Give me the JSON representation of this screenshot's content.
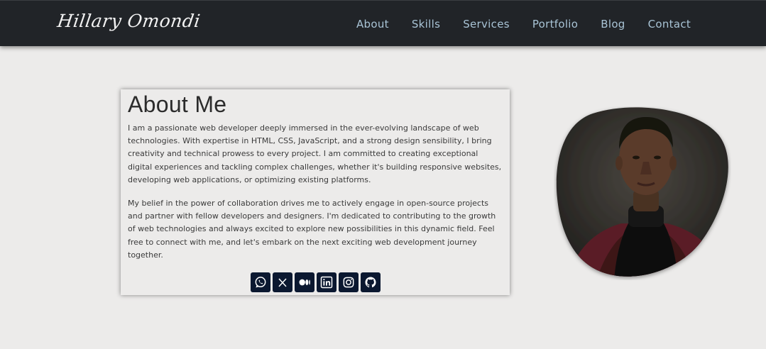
{
  "navbar": {
    "brand": "Hillary Omondi",
    "links": [
      "About",
      "Skills",
      "Services",
      "Portfolio",
      "Blog",
      "Contact"
    ]
  },
  "about": {
    "heading": "About Me",
    "paragraph1": "I am a passionate web developer deeply immersed in the ever-evolving landscape of web technologies. With expertise in HTML, CSS, JavaScript, and a strong design sensibility, I bring creativity and technical prowess to every project. I am committed to creating exceptional digital experiences and tackling complex challenges, whether it's building responsive websites, developing web applications, or optimizing existing platforms.",
    "paragraph2": "My belief in the power of collaboration drives me to actively engage in open-source projects and partner with fellow developers and designers. I'm dedicated to contributing to the growth of web technologies and always excited to explore new possibilities in this dynamic field. Feel free to connect with me, and let's embark on the next exciting web development journey together.",
    "socials": [
      "whatsapp-icon",
      "x-icon",
      "medium-icon",
      "linkedin-icon",
      "instagram-icon",
      "github-icon"
    ]
  },
  "colors": {
    "navbar_bg": "#212428",
    "nav_link": "#a9c4d6",
    "page_bg": "#ecebea",
    "social_bg": "#0b1830"
  }
}
